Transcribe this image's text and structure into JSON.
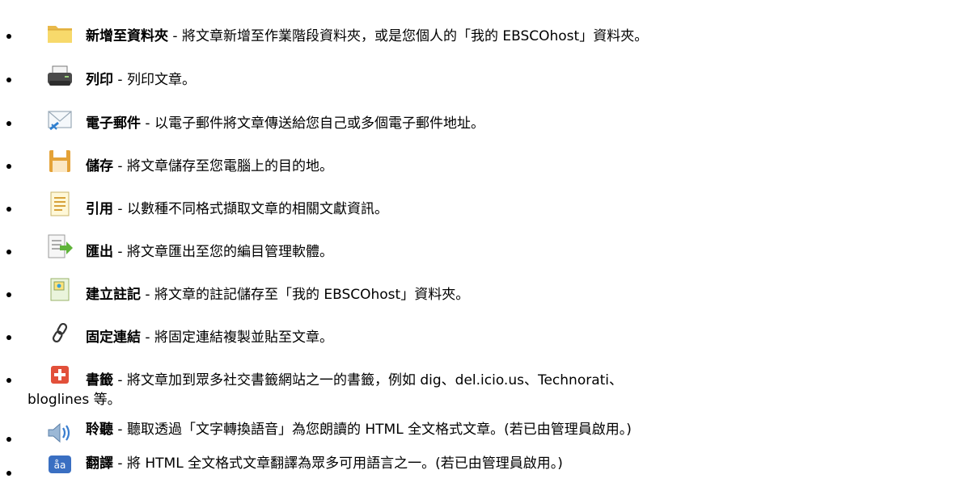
{
  "items": [
    {
      "icon": "folder-add-icon",
      "title": "新增至資料夾",
      "sep": " - ",
      "desc": "將文章新增至作業階段資料夾，或是您個人的「我的 EBSCOhost」資料夾。"
    },
    {
      "icon": "printer-icon",
      "title": "列印",
      "sep": " - ",
      "desc": "列印文章。"
    },
    {
      "icon": "email-icon",
      "title": "電子郵件",
      "sep": " - ",
      "desc": "以電子郵件將文章傳送給您自己或多個電子郵件地址。"
    },
    {
      "icon": "save-disk-icon",
      "title": "儲存",
      "sep": " - ",
      "desc": "將文章儲存至您電腦上的目的地。"
    },
    {
      "icon": "cite-document-icon",
      "title": "引用",
      "sep": " - ",
      "desc": "以數種不同格式擷取文章的相關文獻資訊。"
    },
    {
      "icon": "export-icon",
      "title": "匯出",
      "sep": " - ",
      "desc": "將文章匯出至您的編目管理軟體。"
    },
    {
      "icon": "note-icon",
      "title": "建立註記",
      "sep": " - ",
      "desc": "將文章的註記儲存至「我的 EBSCOhost」資料夾。"
    },
    {
      "icon": "permalink-chain-icon",
      "title": "固定連結",
      "sep": " - ",
      "desc": "將固定連結複製並貼至文章。"
    },
    {
      "icon": "bookmark-plus-icon",
      "title": "書籤",
      "sep": " - ",
      "desc_line1": "將文章加到眾多社交書籤網站之一的書籤，例如 dig、del.icio.us、Technorati、",
      "desc_line2": "bloglines 等。"
    },
    {
      "icon": "speaker-listen-icon",
      "title": "聆聽",
      "sep": " - ",
      "desc": "聽取透過「文字轉換語音」為您朗讀的 HTML 全文格式文章。(若已由管理員啟用。)"
    },
    {
      "icon": "translate-icon",
      "title": "翻譯",
      "sep": " - ",
      "desc": "將 HTML 全文格式文章翻譯為眾多可用語言之一。(若已由管理員啟用。)"
    }
  ],
  "colors": {
    "folder": "#f2c94c",
    "printer": "#555555",
    "save": "#e8a33a",
    "bookmark": "#e2503a",
    "speaker": "#3a7ecf",
    "translate": "#3a6fc2"
  }
}
